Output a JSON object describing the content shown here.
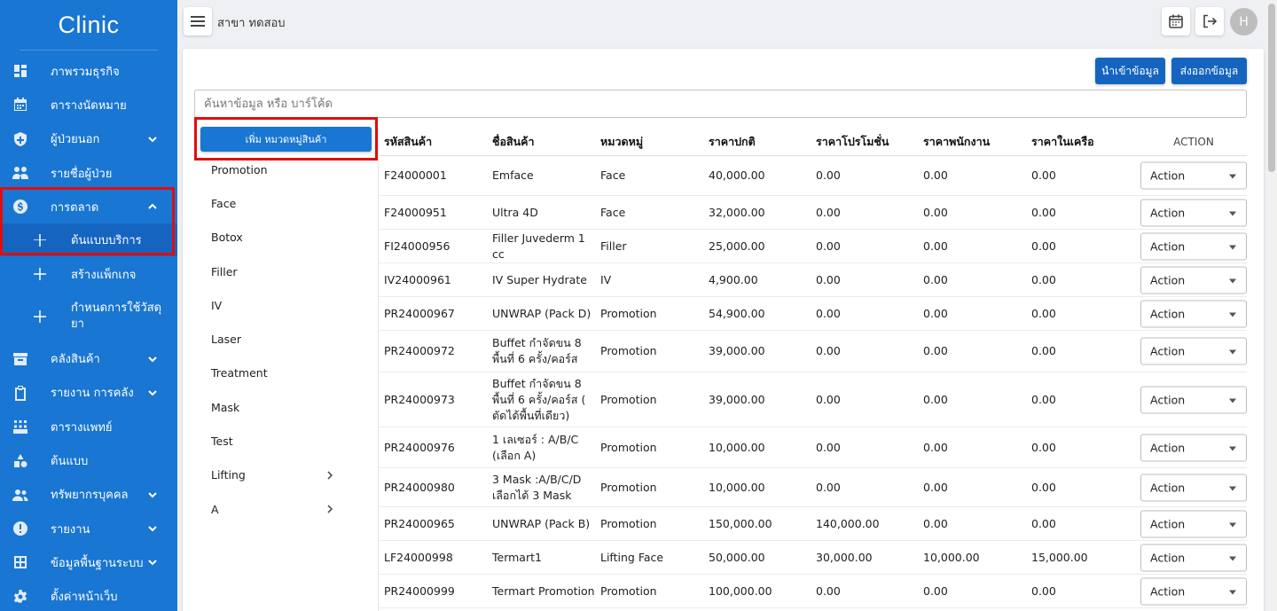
{
  "sidebar": {
    "brand": "Clinic",
    "items": [
      {
        "label": "ภาพรวมธุรกิจ",
        "icon": "dashboard-icon"
      },
      {
        "label": "ตารางนัดหมาย",
        "icon": "calendar-icon"
      },
      {
        "label": "ผู้ป่วยนอก",
        "icon": "shield-icon",
        "expand": "down"
      },
      {
        "label": "รายชื่อผู้ป่วย",
        "icon": "people-icon"
      },
      {
        "label": "การตลาด",
        "icon": "dollar-icon",
        "expand": "up"
      },
      {
        "label": "คลังสินค้า",
        "icon": "archive-icon",
        "expand": "down"
      },
      {
        "label": "รายงาน การคลัง",
        "icon": "clipboard-icon",
        "expand": "down"
      },
      {
        "label": "ตารางแพทย์",
        "icon": "doctor-schedule-icon"
      },
      {
        "label": "ต้นแบบ",
        "icon": "shapes-icon"
      },
      {
        "label": "ทรัพยากรบุคคล",
        "icon": "group-icon",
        "expand": "down"
      },
      {
        "label": "รายงาน",
        "icon": "alert-icon",
        "expand": "down"
      },
      {
        "label": "ข้อมูลพื้นฐานระบบ",
        "icon": "grid-icon",
        "expand": "down"
      },
      {
        "label": "ตั้งค่าหน้าเว็บ",
        "icon": "gear-icon"
      }
    ],
    "subitems": [
      {
        "label": "ต้นแบบบริการ"
      },
      {
        "label": "สร้างแพ็กเกจ"
      },
      {
        "label": "กำหนดการใช้วัสดุ",
        "label2": "ยา"
      }
    ]
  },
  "topbar": {
    "branch": "สาขา ทดสอบ",
    "avatar": "H"
  },
  "toolbar": {
    "import_label": "นำเข้าข้อมูล",
    "export_label": "ส่งออกข้อมูล"
  },
  "search": {
    "placeholder": "ค้นหาข้อมูล หรือ บาร์โค้ด"
  },
  "categories": {
    "add_label": "เพิ่ม หมวดหมู่สินค้า",
    "items": [
      {
        "label": "Promotion"
      },
      {
        "label": "Face"
      },
      {
        "label": "Botox"
      },
      {
        "label": "Filler"
      },
      {
        "label": "IV"
      },
      {
        "label": "Laser"
      },
      {
        "label": "Treatment"
      },
      {
        "label": "Mask"
      },
      {
        "label": "Test"
      },
      {
        "label": "Lifting",
        "has_children": true
      },
      {
        "label": "A",
        "has_children": true
      }
    ]
  },
  "table": {
    "headers": [
      "รหัสสินค้า",
      "ชื่อสินค้า",
      "หมวดหมู่",
      "ราคาปกติ",
      "ราคาโปรโมชั่น",
      "ราคาพนักงาน",
      "ราคาในเครือ",
      "ACTION"
    ],
    "action_label": "Action",
    "rows": [
      {
        "code": "F24000001",
        "name": [
          "Emface"
        ],
        "category": "Face",
        "price": "40,000.00",
        "promo": "0.00",
        "staff": "0.00",
        "group": "0.00"
      },
      {
        "code": "F24000951",
        "name": [
          "Ultra 4D"
        ],
        "category": "Face",
        "price": "32,000.00",
        "promo": "0.00",
        "staff": "0.00",
        "group": "0.00"
      },
      {
        "code": "FI24000956",
        "name": [
          "Filler Juvederm 1 cc"
        ],
        "category": "Filler",
        "price": "25,000.00",
        "promo": "0.00",
        "staff": "0.00",
        "group": "0.00"
      },
      {
        "code": "IV24000961",
        "name": [
          "IV Super Hydrate"
        ],
        "category": "IV",
        "price": "4,900.00",
        "promo": "0.00",
        "staff": "0.00",
        "group": "0.00"
      },
      {
        "code": "PR24000967",
        "name": [
          "UNWRAP (Pack D)"
        ],
        "category": "Promotion",
        "price": "54,900.00",
        "promo": "0.00",
        "staff": "0.00",
        "group": "0.00"
      },
      {
        "code": "PR24000972",
        "name": [
          "Buffet กำจัดขน 8",
          "พื้นที่ 6 ครั้ง/คอร์ส"
        ],
        "category": "Promotion",
        "price": "39,000.00",
        "promo": "0.00",
        "staff": "0.00",
        "group": "0.00"
      },
      {
        "code": "PR24000973",
        "name": [
          "Buffet กำจัดขน 8",
          "พื้นที่ 6 ครั้ง/คอร์ส (",
          "ตัดได้พื้นที่เดียว)"
        ],
        "category": "Promotion",
        "price": "39,000.00",
        "promo": "0.00",
        "staff": "0.00",
        "group": "0.00"
      },
      {
        "code": "PR24000976",
        "name": [
          "1 เลเซอร์ : A/B/C",
          "(เลือก A)"
        ],
        "category": "Promotion",
        "price": "10,000.00",
        "promo": "0.00",
        "staff": "0.00",
        "group": "0.00"
      },
      {
        "code": "PR24000980",
        "name": [
          "3 Mask :A/B/C/D",
          "เลือกได้ 3 Mask"
        ],
        "category": "Promotion",
        "price": "10,000.00",
        "promo": "0.00",
        "staff": "0.00",
        "group": "0.00"
      },
      {
        "code": "PR24000965",
        "name": [
          "UNWRAP (Pack B)"
        ],
        "category": "Promotion",
        "price": "150,000.00",
        "promo": "140,000.00",
        "staff": "0.00",
        "group": "0.00"
      },
      {
        "code": "LF24000998",
        "name": [
          "Termart1"
        ],
        "category": "Lifting Face",
        "price": "50,000.00",
        "promo": "30,000.00",
        "staff": "10,000.00",
        "group": "15,000.00"
      },
      {
        "code": "PR24000999",
        "name": [
          "Termart Promotion"
        ],
        "category": "Promotion",
        "price": "100,000.00",
        "promo": "0.00",
        "staff": "0.00",
        "group": "0.00"
      }
    ]
  },
  "colors": {
    "sidebar": "#1976d2",
    "primary_button": "#1565c0",
    "highlight": "#e10d0d"
  }
}
